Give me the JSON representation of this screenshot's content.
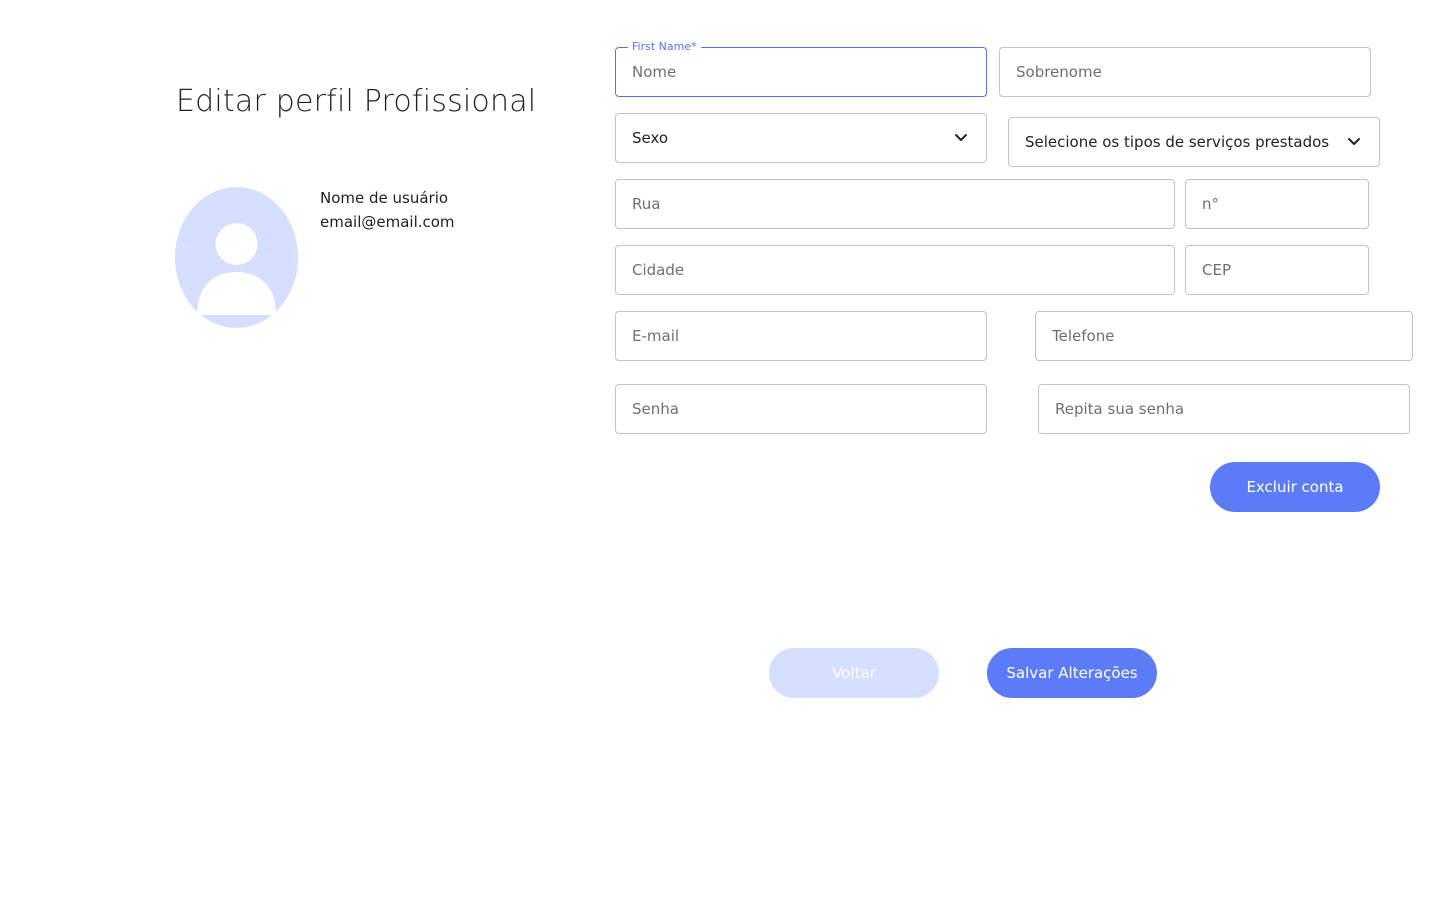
{
  "page": {
    "title": "Editar perfil Profissional"
  },
  "profile": {
    "username": "Nome de usuário",
    "email": "email@email.com",
    "avatar_icon": "user-avatar-icon",
    "avatar_color": "#d5dfff"
  },
  "form": {
    "first_name": {
      "label": "First Name*",
      "placeholder": "Nome",
      "value": ""
    },
    "last_name": {
      "placeholder": "Sobrenome",
      "value": ""
    },
    "gender": {
      "selected": "Sexo"
    },
    "services": {
      "selected": "Selecione os tipos de serviços prestados"
    },
    "street": {
      "placeholder": "Rua",
      "value": ""
    },
    "number": {
      "placeholder": "n°",
      "value": ""
    },
    "city": {
      "placeholder": "Cidade",
      "value": ""
    },
    "zip": {
      "placeholder": "CEP",
      "value": ""
    },
    "email": {
      "placeholder": "E-mail",
      "value": ""
    },
    "phone": {
      "placeholder": "Telefone",
      "value": ""
    },
    "password": {
      "placeholder": "Senha",
      "value": ""
    },
    "password_repeat": {
      "placeholder": "Repita sua senha",
      "value": ""
    }
  },
  "actions": {
    "delete_account": "Excluir conta",
    "back": "Voltar",
    "save": "Salvar Alterações"
  },
  "colors": {
    "accent": "#5b7cf6",
    "accent_light": "#d5dfff",
    "focus_border": "#5a72e8"
  }
}
